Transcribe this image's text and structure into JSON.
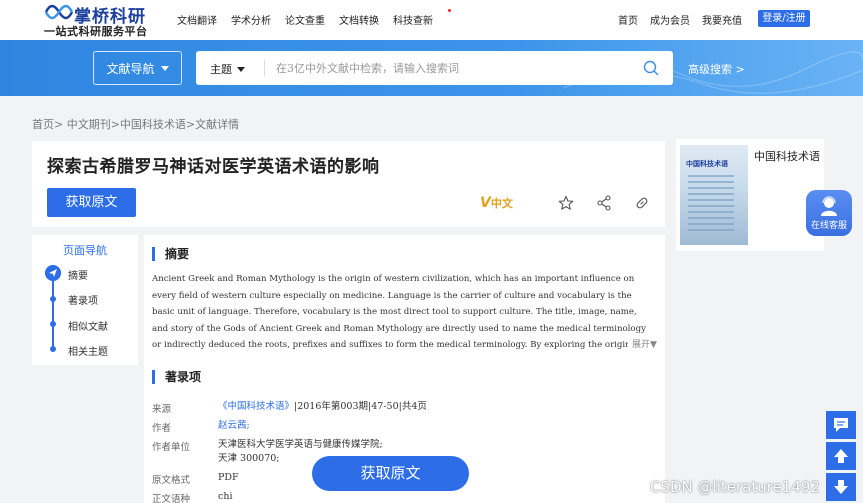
{
  "header": {
    "logo_title": "掌桥科研",
    "logo_subtitle": "一站式科研服务平台",
    "nav": [
      "文档翻译",
      "学术分析",
      "论文查重",
      "文档转换",
      "科技查新"
    ],
    "right_nav": [
      "首页",
      "成为会员",
      "我要充值"
    ],
    "login_label": "登录/注册"
  },
  "search": {
    "nav_select": "文献导航",
    "type": "主题",
    "placeholder": "在3亿中外文献中检索，请输入搜索词",
    "advanced": "高级搜索 >"
  },
  "breadcrumb": "首页> 中文期刊>中国科技术语>文献详情",
  "article": {
    "title": "探索古希腊罗马神话对医学英语术语的影响",
    "get_original": "获取原文",
    "lang_badge": "中文",
    "lang_badge_mark": "V"
  },
  "journal": {
    "name": "中国科技术语",
    "cover_title": "中国科技术语"
  },
  "service": {
    "label": "在线客服"
  },
  "page_nav": {
    "title": "页面导航",
    "items": [
      "摘要",
      "著录项",
      "相似文献",
      "相关主题"
    ]
  },
  "abstract": {
    "heading": "摘要",
    "text": "Ancient Greek and Roman Mythology is the origin of western civilization, which has an important influence on every field of western culture especially on medicine. Language is the carrier of culture and vocabulary is the basic unit of language. Therefore, vocabulary is the most direct tool to support culture. The title, image, name, and story of the Gods of Ancient Greek and Roman Mythology are directly used to name the medical terminology or indirectly deduced the roots, prefixes and suffixes to form the medical terminology. By exploring the origin of medical terms in ancient Greek and Roman mythology, it is helpful to unc",
    "expand": "展开▼"
  },
  "record": {
    "heading": "著录项",
    "source_label": "来源",
    "source_link": "《中国科技术语》",
    "source_rest": "|2016年第003期|47-50|共4页",
    "author_label": "作者",
    "author": "赵云茜;",
    "unit_label": "作者单位",
    "unit_line1": "天津医科大学医学英语与健康传媒学院;",
    "unit_line2": "天津 300070;",
    "format_label": "原文格式",
    "format": "PDF",
    "lang_label": "正文语种",
    "lang": "chi"
  },
  "float_get": "获取原文",
  "watermark": "CSDN @literature1492"
}
